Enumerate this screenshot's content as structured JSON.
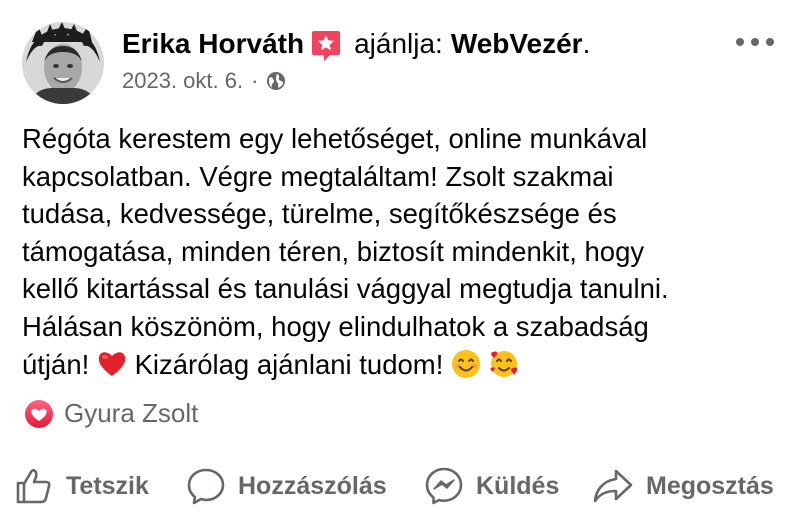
{
  "post": {
    "author": "Erika Horváth",
    "recommend_verb": "ajánlja:",
    "page_name": "WebVezér",
    "page_name_suffix": ".",
    "date": "2023. okt. 6.",
    "separator": "·",
    "privacy_icon": "globe-icon",
    "more_icon": "more-options-icon",
    "body_lines": [
      "Régóta kerestem egy lehetőséget, online munkával",
      "kapcsolatban. Végre megtaláltam! Zsolt szakmai",
      "tudása, kedvessége, türelme, segítőkészsége és",
      "támogatása, minden téren, biztosít mindenkit, hogy",
      "kellő kitartással és tanulási vággyal megtudja tanulni.",
      "Hálásan köszönöm, hogy elindulhatok a szabadság"
    ],
    "body_last_line": {
      "part1": "útján!",
      "part2": "Kizárólag ajánlani tudom!"
    },
    "emojis": [
      "red-heart-emoji",
      "smiling-face-emoji",
      "smiling-face-with-hearts-emoji"
    ],
    "reaction_icon": "love-reaction-icon",
    "reaction_user": "Gyura Zsolt",
    "actions": {
      "like": "Tetszik",
      "comment": "Hozzászólás",
      "send": "Küldés",
      "share": "Megosztás"
    },
    "colors": {
      "text": "#050505",
      "secondary": "#65676b",
      "recommend_pink": "#f3425f",
      "love_red": "#f33e58"
    }
  }
}
